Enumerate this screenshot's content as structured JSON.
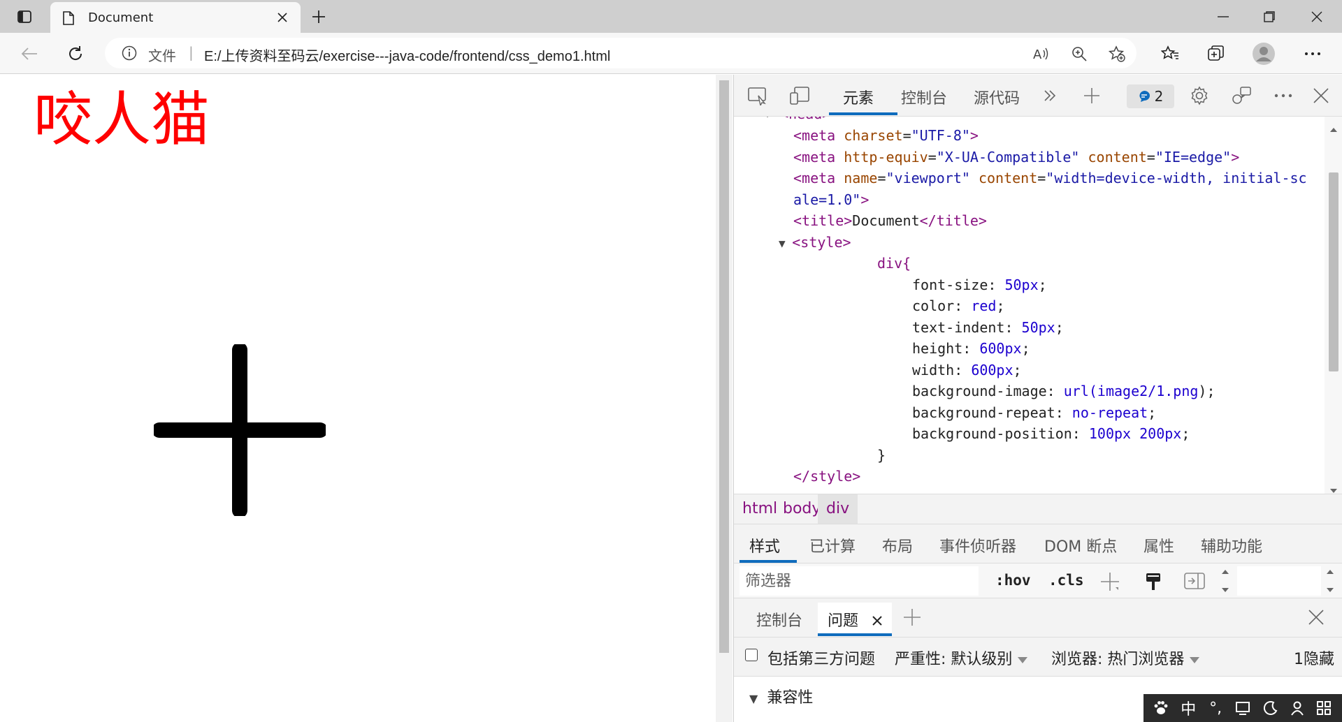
{
  "browser": {
    "tab_title": "Document",
    "address": {
      "scheme_label": "文件",
      "separator": "|",
      "url": "E:/上传资料至码云/exercise---java-code/frontend/css_demo1.html"
    }
  },
  "page": {
    "div_text": "咬人猫",
    "div_color": "#ff0000"
  },
  "devtools": {
    "tabs": [
      "元素",
      "控制台",
      "源代码"
    ],
    "issues_count": "2",
    "dom_lines": {
      "l0": "<head>",
      "l1": {
        "tag_open": "<meta",
        "a1": "charset",
        "v1": "\"UTF-8\"",
        "close": ">"
      },
      "l2": {
        "tag_open": "<meta",
        "a1": "http-equiv",
        "v1": "\"X-UA-Compatible\"",
        "a2": "content",
        "v2": "\"IE=edge\"",
        "close": ">"
      },
      "l3": {
        "tag_open": "<meta",
        "a1": "name",
        "v1": "\"viewport\"",
        "a2": "content",
        "v2": "\"width=device-width, initial-sc"
      },
      "l4": {
        "v_cont": "ale=1.0\"",
        "close": ">"
      },
      "l5": {
        "open": "<title>",
        "text": "Document",
        "close": "</title>"
      },
      "l6": "<style>",
      "l7": "div{",
      "css": [
        {
          "prop": "font-size",
          "value": "50px"
        },
        {
          "prop": "color",
          "value": "red"
        },
        {
          "prop": "text-indent",
          "value": "50px"
        },
        {
          "prop": "height",
          "value": "600px"
        },
        {
          "prop": "width",
          "value": "600px"
        },
        {
          "prop": "background-image",
          "fn": "url(",
          "value": "image2/1.png",
          "end": ")"
        },
        {
          "prop": "background-repeat",
          "value": "no-repeat"
        },
        {
          "prop": "background-position",
          "value": "100px 200px"
        }
      ],
      "l16": "}",
      "l17": "</style>"
    },
    "breadcrumb": [
      "html",
      "body",
      "div"
    ],
    "sub_tabs": [
      "样式",
      "已计算",
      "布局",
      "事件侦听器",
      "DOM 断点",
      "属性",
      "辅助功能"
    ],
    "filter": {
      "placeholder": "筛选器",
      "hov": ":hov",
      "cls": ".cls"
    },
    "drawer": {
      "tabs": [
        "控制台",
        "问题"
      ],
      "include_third_party": "包括第三方问题",
      "severity": "严重性: 默认级别",
      "browsers": "浏览器: 热门浏览器",
      "hidden_count": "1隐藏",
      "section": "兼容性"
    }
  },
  "ime": {
    "lang": "中",
    "punct": "°,"
  },
  "icons": [
    "tab-actions-icon",
    "document-icon",
    "close-icon",
    "new-tab-icon",
    "minimize-icon",
    "maximize-icon",
    "window-close-icon",
    "back-icon",
    "reload-icon",
    "info-icon",
    "read-aloud-icon",
    "zoom-icon",
    "add-favorite-icon",
    "favorites-icon",
    "collections-icon",
    "profile-icon",
    "more-icon",
    "inspect-icon",
    "device-icon",
    "more-tabs-icon",
    "add-tool-icon",
    "settings-icon",
    "feedback-icon",
    "menu-dots-icon",
    "devtools-close-icon",
    "paint-icon",
    "computed-toggle-icon"
  ],
  "colors": {
    "accent": "#0f6cbd",
    "tag": "#881280",
    "attr": "#994500",
    "value": "#1a1aa6"
  }
}
